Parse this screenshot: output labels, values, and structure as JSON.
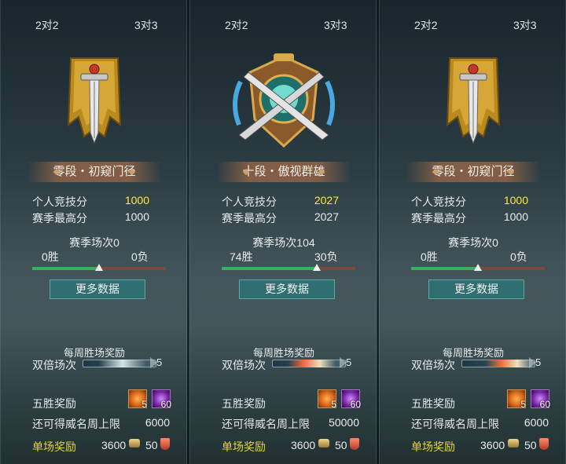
{
  "panels": [
    {
      "tab_2v2": "2对2",
      "tab_3v3": "3对3",
      "emblem": "banner-sword-icon",
      "rank_title": "零段・初窥门径",
      "personal_score_label": "个人竞技分",
      "personal_score": "1000",
      "season_high_label": "赛季最高分",
      "season_high": "1000",
      "season_matches": "赛季场次0",
      "wins": "0胜",
      "losses": "0负",
      "win_ratio": 0.5,
      "more_data": "更多数据",
      "weekly_reward": "每周胜场奖励",
      "double_label": "双倍场次",
      "double_count": "5",
      "five_win_label": "五胜奖励",
      "reward_item1_count": "5",
      "reward_item2_count": "60",
      "prestige_label": "还可得威名周上限",
      "prestige_value": "6000",
      "single_reward_label": "单场奖励",
      "single_coins": "3600",
      "single_shield": "50"
    },
    {
      "tab_2v2": "2对2",
      "tab_3v3": "3对3",
      "emblem": "crossed-swords-shield-icon",
      "rank_title": "十段・傲视群雄",
      "personal_score_label": "个人竞技分",
      "personal_score": "2027",
      "season_high_label": "赛季最高分",
      "season_high": "2027",
      "season_matches": "赛季场次104",
      "wins": "74胜",
      "losses": "30负",
      "win_ratio": 0.71,
      "more_data": "更多数据",
      "weekly_reward": "每周胜场奖励",
      "double_label": "双倍场次",
      "double_count": "5",
      "five_win_label": "五胜奖励",
      "reward_item1_count": "5",
      "reward_item2_count": "60",
      "prestige_label": "还可得威名周上限",
      "prestige_value": "50000",
      "single_reward_label": "单场奖励",
      "single_coins": "3600",
      "single_shield": "50"
    },
    {
      "tab_2v2": "2对2",
      "tab_3v3": "3对3",
      "emblem": "banner-sword-icon",
      "rank_title": "零段・初窥门径",
      "personal_score_label": "个人竞技分",
      "personal_score": "1000",
      "season_high_label": "赛季最高分",
      "season_high": "1000",
      "season_matches": "赛季场次0",
      "wins": "0胜",
      "losses": "0负",
      "win_ratio": 0.5,
      "more_data": "更多数据",
      "weekly_reward": "每周胜场奖励",
      "double_label": "双倍场次",
      "double_count": "5",
      "five_win_label": "五胜奖励",
      "reward_item1_count": "5",
      "reward_item2_count": "60",
      "prestige_label": "还可得威名周上限",
      "prestige_value": "6000",
      "single_reward_label": "单场奖励",
      "single_coins": "3600",
      "single_shield": "50"
    }
  ],
  "colors": {
    "score_yellow": "#ffea3a",
    "win_green": "#3bb05c",
    "loss_brown": "#7b4a38",
    "button_teal": "#2f6f72"
  }
}
